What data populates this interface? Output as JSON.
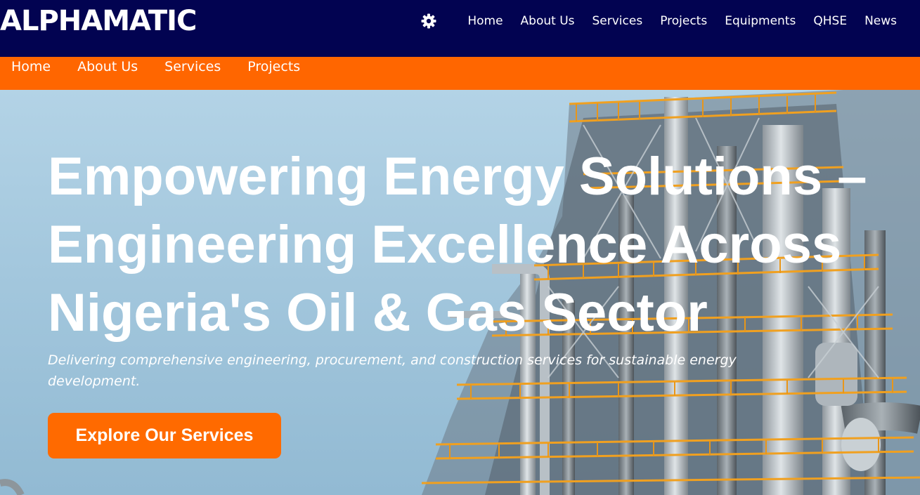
{
  "header": {
    "brand": "ALPHAMATIC",
    "settings_icon": "gear-icon",
    "nav": [
      "Home",
      "About Us",
      "Services",
      "Projects",
      "Equipments",
      "QHSE",
      "News"
    ]
  },
  "subnav": {
    "items": [
      "Home",
      "About Us",
      "Services",
      "Projects"
    ]
  },
  "hero": {
    "title_lines": [
      "Empowering Energy Solutions –",
      "Engineering Excellence Across",
      "Nigeria's Oil & Gas Sector"
    ],
    "subtitle": "Delivering comprehensive engineering, procurement, and construction services for sustainable energy development.",
    "cta_label": "Explore Our Services"
  },
  "colors": {
    "header_bg": "#020351",
    "subnav_bg": "#ff6600",
    "cta_bg": "#ff6a00",
    "text": "#ffffff"
  }
}
